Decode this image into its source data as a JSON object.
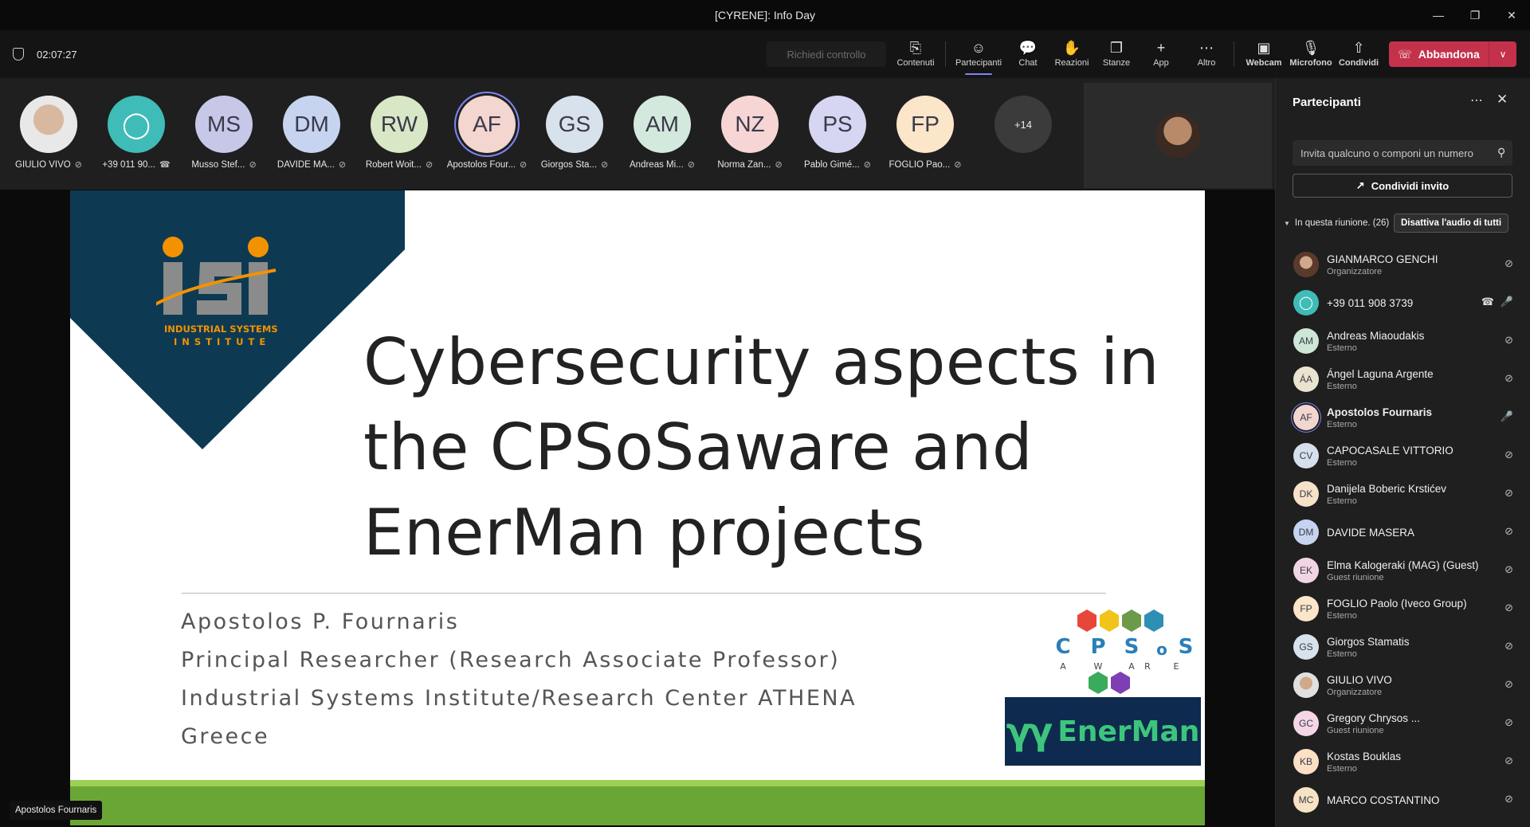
{
  "window": {
    "title": "[CYRENE]: Info Day"
  },
  "toolbar": {
    "timer": "02:07:27",
    "request_control": "Richiedi controllo",
    "buttons": {
      "contenuti": "Contenuti",
      "partecipanti": "Partecipanti",
      "chat": "Chat",
      "reazioni": "Reazioni",
      "stanze": "Stanze",
      "app": "App",
      "altro": "Altro",
      "webcam": "Webcam",
      "microfono": "Microfono",
      "condividi": "Condividi"
    },
    "leave": "Abbandona"
  },
  "strip": {
    "tiles": [
      {
        "initials": "",
        "name": "GIULIO VIVO",
        "color": "#c9c9c9"
      },
      {
        "initials": "",
        "name": "+39 011 90...",
        "color": "#3fbcb7"
      },
      {
        "initials": "MS",
        "name": "Musso Stef...",
        "color": "#c7c7e8"
      },
      {
        "initials": "DM",
        "name": "DAVIDE MA...",
        "color": "#c6d4f0"
      },
      {
        "initials": "RW",
        "name": "Robert Woit...",
        "color": "#d8e7c5"
      },
      {
        "initials": "AF",
        "name": "Apostolos Four...",
        "color": "#f3d6cf"
      },
      {
        "initials": "GS",
        "name": "Giorgos Sta...",
        "color": "#d8e2ec"
      },
      {
        "initials": "AM",
        "name": "Andreas Mi...",
        "color": "#d3e9dd"
      },
      {
        "initials": "NZ",
        "name": "Norma Zan...",
        "color": "#f7d5d5"
      },
      {
        "initials": "PS",
        "name": "Pablo Gimé...",
        "color": "#d6d6f2"
      },
      {
        "initials": "FP",
        "name": "FOGLIO Pao...",
        "color": "#fbe6c9"
      }
    ],
    "more": "+14"
  },
  "slide": {
    "logo_text": "iSi",
    "logo_caption": [
      "INDUSTRIAL SYSTEMS",
      "INSTITUTE"
    ],
    "title_lines": [
      "Cybersecurity aspects in",
      "the CPSoSaware and",
      "EnerMan projects"
    ],
    "subtitle_lines": [
      "Apostolos P. Fournaris",
      "Principal Researcher (Research Associate Professor)",
      "Industrial Systems Institute/Research Center ATHENA",
      "Greece"
    ],
    "cpsos_letters": [
      "C",
      "P",
      "S",
      "o",
      "S"
    ],
    "cpsos_sub": [
      "A",
      "W",
      "A",
      "R",
      "E"
    ],
    "enerman_text": "EnerMan"
  },
  "speaker_label": "Apostolos Fournaris",
  "pane": {
    "title": "Partecipanti",
    "invite_placeholder": "Invita qualcuno o componi un numero",
    "share_invite": "Condividi invito",
    "in_meeting": "In questa riunione. (26)",
    "mute_all": "Disattiva l'audio di tutti",
    "people": [
      {
        "initials": "",
        "name": "GIANMARCO GENCHI",
        "role": "Organizzatore",
        "color": "#8a5a3c",
        "bold": false
      },
      {
        "initials": "",
        "name": "+39 011 908 3739",
        "role": "",
        "color": "#3fbcb7",
        "bold": false
      },
      {
        "initials": "AM",
        "name": "Andreas Miaoudakis",
        "role": "Esterno",
        "color": "#cde6d5",
        "bold": false
      },
      {
        "initials": "ÁA",
        "name": "Ángel Laguna Argente",
        "role": "Esterno",
        "color": "#e9e3cf",
        "bold": false
      },
      {
        "initials": "AF",
        "name": "Apostolos Fournaris",
        "role": "Esterno",
        "color": "#f3d6cf",
        "bold": true
      },
      {
        "initials": "CV",
        "name": "CAPOCASALE VITTORIO",
        "role": "Esterno",
        "color": "#d5e0ec",
        "bold": false
      },
      {
        "initials": "DK",
        "name": "Danijela Boberic Krstićev",
        "role": "Esterno",
        "color": "#f5e2c8",
        "bold": false
      },
      {
        "initials": "DM",
        "name": "DAVIDE MASERA",
        "role": "",
        "color": "#c6d4f0",
        "bold": false
      },
      {
        "initials": "EK",
        "name": "Elma Kalogeraki (MAG) (Guest)",
        "role": "Guest riunione",
        "color": "#f1d5e4",
        "bold": false
      },
      {
        "initials": "FP",
        "name": "FOGLIO Paolo (Iveco Group)",
        "role": "Esterno",
        "color": "#fbe6c9",
        "bold": false
      },
      {
        "initials": "GS",
        "name": "Giorgos Stamatis",
        "role": "Esterno",
        "color": "#d8e2ec",
        "bold": false
      },
      {
        "initials": "",
        "name": "GIULIO VIVO",
        "role": "Organizzatore",
        "color": "#c9c9c9",
        "bold": false
      },
      {
        "initials": "GC",
        "name": "Gregory Chrysos ...",
        "role": "Guest riunione",
        "color": "#f5d6e6",
        "bold": false
      },
      {
        "initials": "KB",
        "name": "Kostas Bouklas",
        "role": "Esterno",
        "color": "#fbe0c6",
        "bold": false
      },
      {
        "initials": "MC",
        "name": "MARCO COSTANTINO",
        "role": "",
        "color": "#f7e3c4",
        "bold": false
      }
    ]
  },
  "colors": {
    "accent": "#7f85f5",
    "leave": "#c4314b",
    "slide_diamond": "#0d3a52",
    "isi_orange": "#f39200",
    "slide_green": "#6aa636",
    "enerman_bg": "#0f2a4f",
    "enerman_green": "#3cc67c"
  },
  "icons": {
    "shield": "shield-icon",
    "mic_off": "mic-off-icon",
    "mic_on": "mic-icon",
    "search": "search-icon"
  }
}
